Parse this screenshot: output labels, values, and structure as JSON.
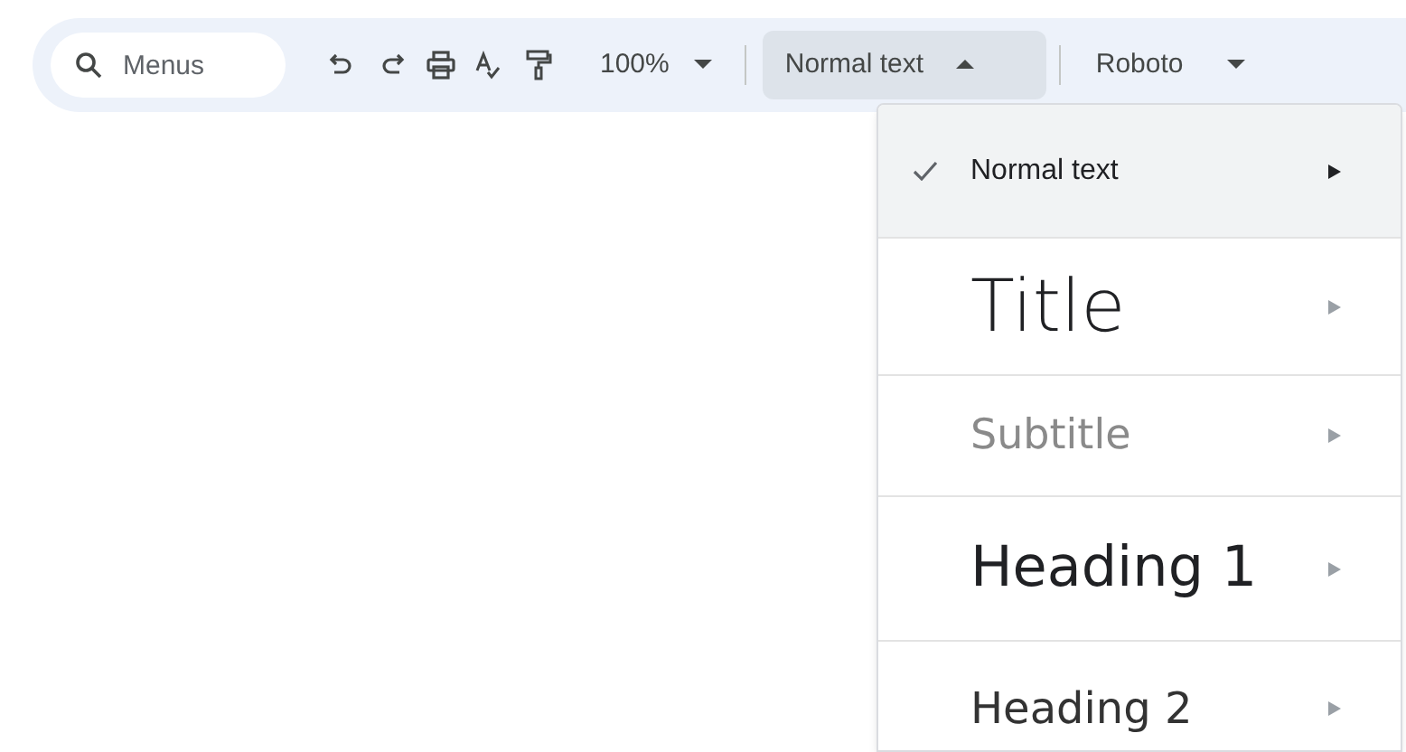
{
  "toolbar": {
    "search": {
      "placeholder": "Menus"
    },
    "zoom": "100%",
    "style_dropdown": {
      "value": "Normal text",
      "expanded": true
    },
    "font_dropdown": {
      "value": "Roboto"
    }
  },
  "style_menu": [
    {
      "label": "Normal text",
      "kind": "normal",
      "selected": true
    },
    {
      "label": "Title",
      "kind": "title",
      "selected": false
    },
    {
      "label": "Subtitle",
      "kind": "subtitle",
      "selected": false
    },
    {
      "label": "Heading 1",
      "kind": "heading1",
      "selected": false
    },
    {
      "label": "Heading 2",
      "kind": "heading2",
      "selected": false
    }
  ]
}
